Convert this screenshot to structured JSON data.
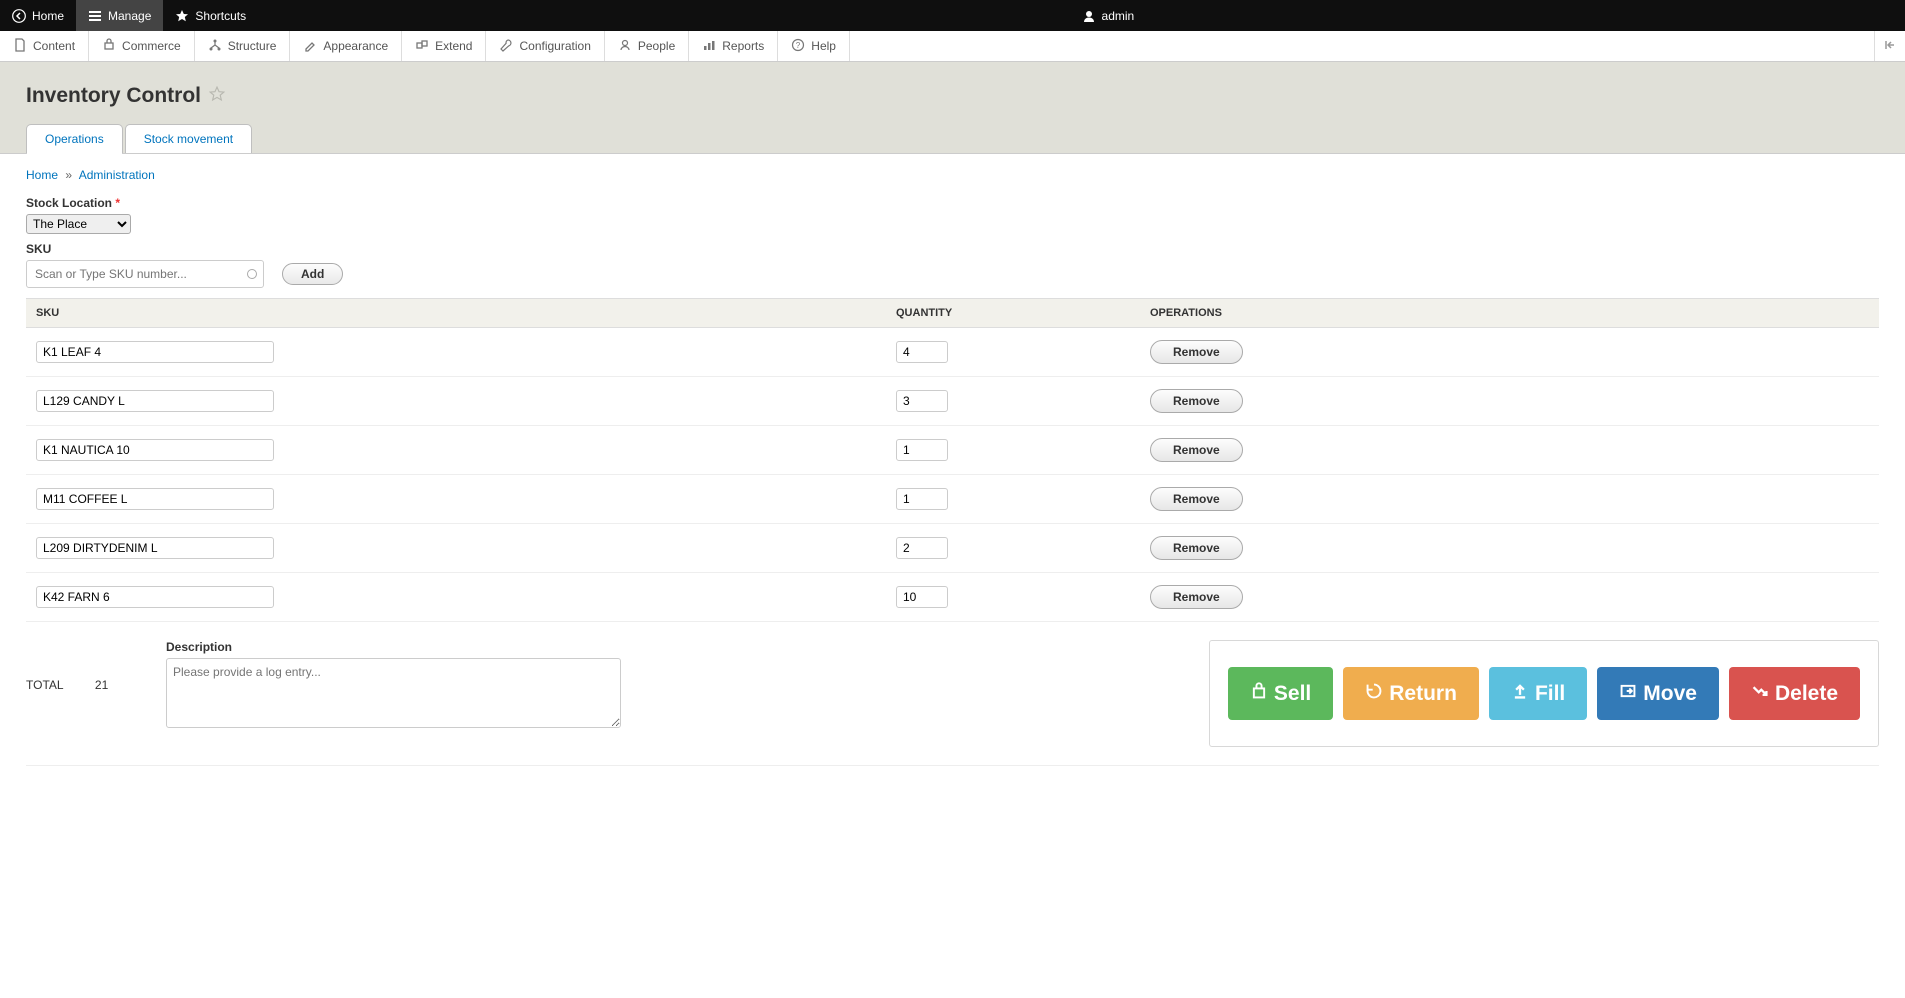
{
  "topbar": {
    "home": "Home",
    "manage": "Manage",
    "shortcuts": "Shortcuts",
    "user": "admin"
  },
  "secondbar": {
    "content": "Content",
    "commerce": "Commerce",
    "structure": "Structure",
    "appearance": "Appearance",
    "extend": "Extend",
    "configuration": "Configuration",
    "people": "People",
    "reports": "Reports",
    "help": "Help"
  },
  "page": {
    "title": "Inventory Control",
    "tabs": {
      "operations": "Operations",
      "movement": "Stock movement"
    }
  },
  "breadcrumb": {
    "home": "Home",
    "sep": "»",
    "admin": "Administration"
  },
  "form": {
    "stock_location_label": "Stock Location",
    "stock_location_value": "The Place",
    "sku_label": "SKU",
    "sku_placeholder": "Scan or Type SKU number...",
    "add_btn": "Add"
  },
  "grid": {
    "headers": {
      "sku": "SKU",
      "qty": "QUANTITY",
      "ops": "OPERATIONS"
    },
    "remove_label": "Remove",
    "rows": [
      {
        "sku": "K1 LEAF 4",
        "qty": "4"
      },
      {
        "sku": "L129 CANDY L",
        "qty": "3"
      },
      {
        "sku": "K1 NAUTICA 10",
        "qty": "1"
      },
      {
        "sku": "M11 COFFEE L",
        "qty": "1"
      },
      {
        "sku": "L209 DIRTYDENIM L",
        "qty": "2"
      },
      {
        "sku": "K42 FARN 6",
        "qty": "10"
      }
    ]
  },
  "footer": {
    "total_label": "TOTAL",
    "total_value": "21",
    "desc_label": "Description",
    "desc_placeholder": "Please provide a log entry...",
    "actions": {
      "sell": "Sell",
      "return": "Return",
      "fill": "Fill",
      "move": "Move",
      "delete": "Delete"
    }
  }
}
